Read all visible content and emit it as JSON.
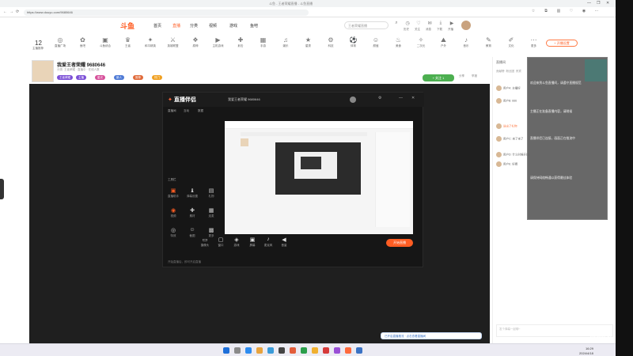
{
  "browser": {
    "window_title": "斗鱼 - 王者荣耀直播 - 斗鱼直播",
    "url": "https://www.douyu.com/9680646",
    "controls": [
      "—",
      "❐",
      "✕"
    ]
  },
  "site": {
    "logo": "斗鱼",
    "nav": [
      "首页",
      "直播",
      "分类",
      "视频",
      "游戏",
      "鱼吧"
    ],
    "search_placeholder": "王者荣耀直播",
    "header_icons": [
      "历史",
      "关注",
      "消息",
      "下载",
      "开播"
    ]
  },
  "category_bar": {
    "count": "12",
    "count_label": "主播推荐",
    "items": [
      "直播广场",
      "鱼吧",
      "斗鱼综合",
      "王者",
      "和平精英",
      "英雄联盟",
      "原神",
      "主机游戏",
      "射击",
      "手游",
      "娱乐",
      "星秀",
      "科技",
      "体育",
      "颜值",
      "美食",
      "二次元",
      "户外",
      "音乐",
      "教育",
      "文化",
      "更多"
    ],
    "sub_button": "+ 开播设置"
  },
  "room": {
    "title": "我爱王者荣耀 9680646",
    "meta": "分类: 王者荣耀 · 直播中 · 在线人数",
    "tags": [
      "王者荣耀",
      "主播",
      "星光",
      "新人",
      "推荐",
      "热门"
    ],
    "tag_colors": [
      "#7b4fd6",
      "#7b4fd6",
      "#d64f9a",
      "#4f7bd6",
      "#e06a3a",
      "#f0a020"
    ],
    "follow_button": "+ 关注 1",
    "right_labels": [
      "分享",
      "举报"
    ]
  },
  "stream_app": {
    "name": "直播伴侣",
    "title_text": "我爱王者荣耀 9680646",
    "tabs": [
      "直播间",
      "互动",
      "数据"
    ],
    "side_section": "工具栏",
    "side_buttons": [
      "直播助手",
      "弹幕设置",
      "礼物",
      "视频",
      "素材",
      "连麦",
      "特效",
      "截图",
      "更多"
    ],
    "bottom_items": [
      "摄像头",
      "窗口",
      "游戏",
      "屏幕",
      "麦克风",
      "音量"
    ],
    "start_button": "开始直播",
    "status": "开始直播后，即可开启直播"
  },
  "banner": "已开启直播推流 · 点击查看直播间",
  "chat": {
    "header": "直播间",
    "tabs": [
      "贡献榜",
      "粉丝团",
      "贵宾"
    ],
    "messages": [
      "用户A: 主播好",
      "用户B: 666",
      "送出了礼物",
      "用户C: 来了来了",
      "用户D: 什么时候开始",
      "用户E: 好看"
    ],
    "input_placeholder": "发个弹幕一起聊~"
  },
  "overlay": {
    "lines": [
      "欢迎来到斗鱼直播间，请遵守直播规范",
      "主播正在准备直播内容，请稍候",
      "直播伴侣已连接，画面正在推流中",
      "请保持网络畅通以获得最佳体验"
    ]
  },
  "taskbar": {
    "time": "16:29",
    "date": "2024/4/18"
  },
  "watermark": "9680646"
}
